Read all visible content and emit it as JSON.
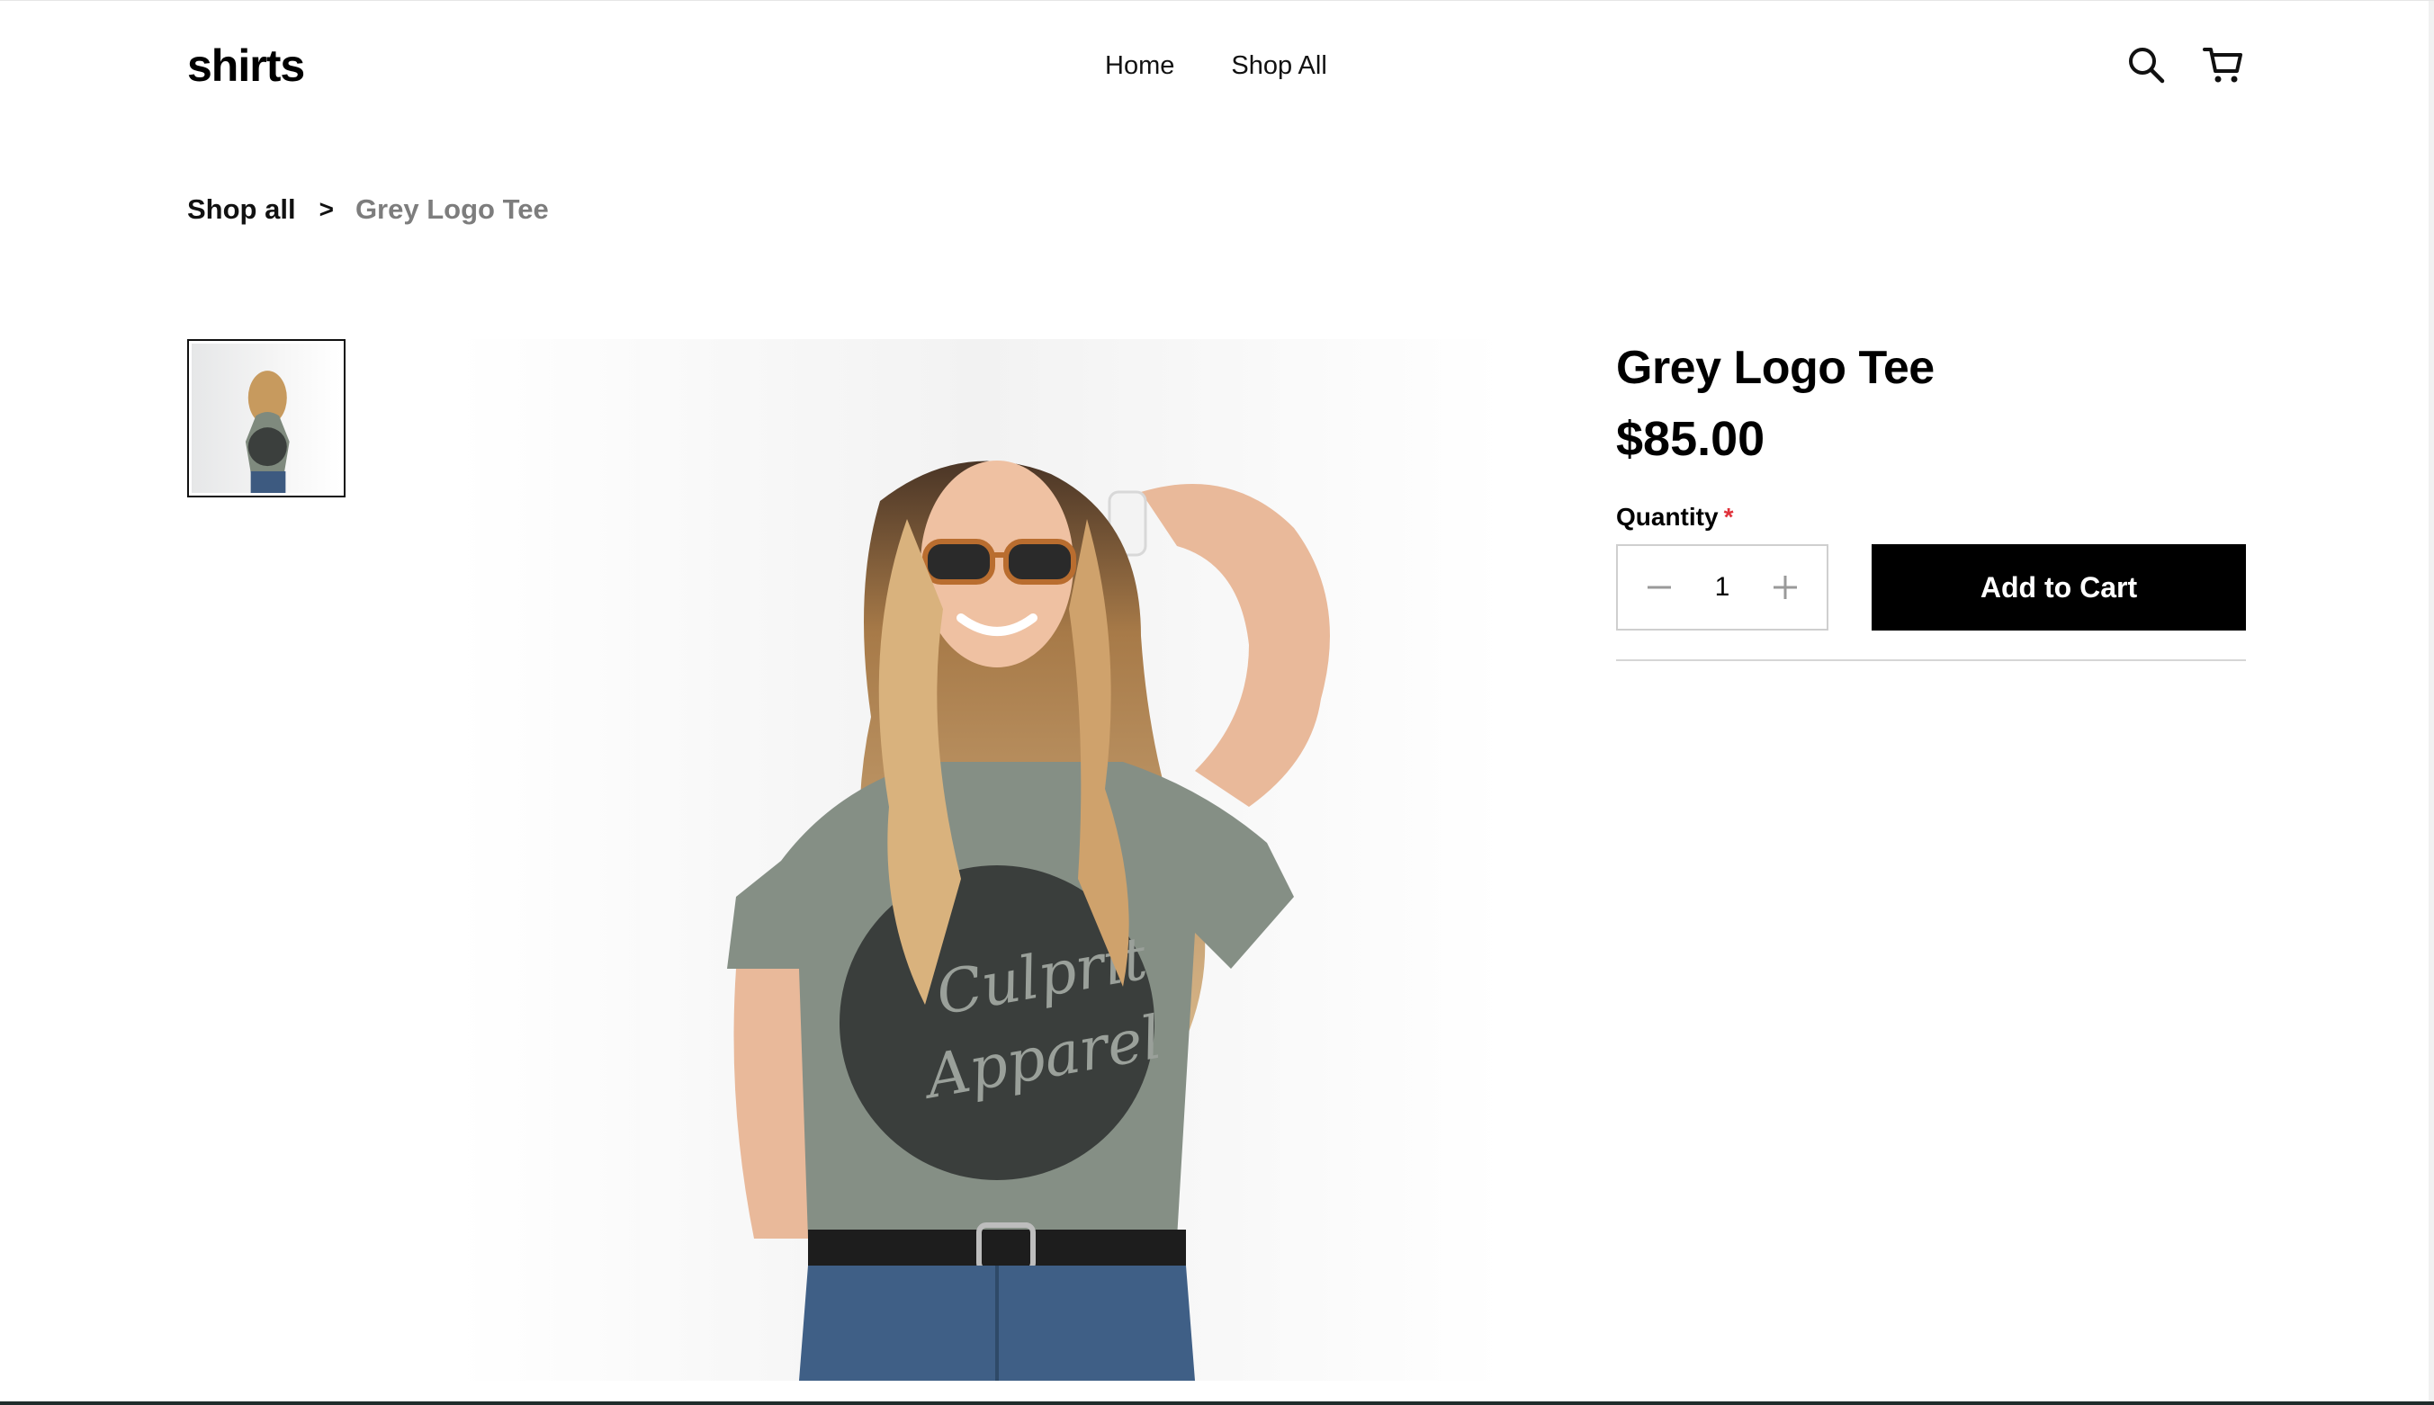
{
  "store": {
    "logo_text": "shirts"
  },
  "nav": {
    "items": [
      {
        "label": "Home"
      },
      {
        "label": "Shop All"
      }
    ]
  },
  "header_icons": {
    "search": "search-icon",
    "cart": "cart-icon"
  },
  "breadcrumb": {
    "parent": "Shop all",
    "separator": ">",
    "current": "Grey Logo Tee"
  },
  "product": {
    "title": "Grey Logo Tee",
    "price": "$85.00",
    "quantity_label": "Quantity",
    "required_marker": "*",
    "quantity": "1",
    "add_to_cart_label": "Add to Cart",
    "shirt_print": "Culprit Apparel"
  },
  "colors": {
    "accent": "#000000",
    "required": "#e0313a",
    "muted_text": "#7d7d7d",
    "border": "#cfcfcf"
  }
}
